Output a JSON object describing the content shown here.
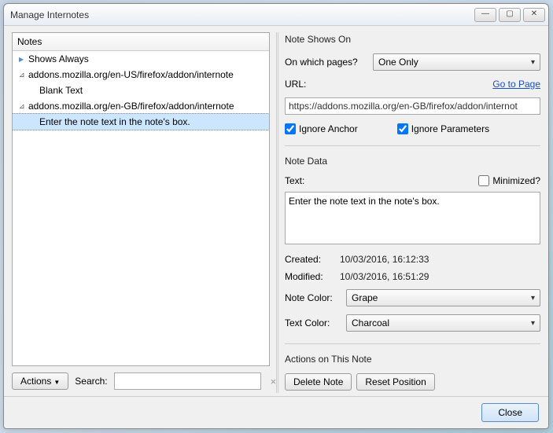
{
  "title": "Manage Internotes",
  "left": {
    "header": "Notes",
    "rows": [
      {
        "level": 1,
        "label": "Shows Always",
        "icon": "right"
      },
      {
        "level": 1,
        "label": "addons.mozilla.org/en-US/firefox/addon/internote",
        "icon": "down"
      },
      {
        "level": 2,
        "label": "Blank Text"
      },
      {
        "level": 1,
        "label": "addons.mozilla.org/en-GB/firefox/addon/internote",
        "icon": "down"
      },
      {
        "level": 2,
        "label": "Enter the note text in the note's box.",
        "selected": true
      }
    ],
    "actions_label": "Actions",
    "search_label": "Search:"
  },
  "right": {
    "group_shows": "Note Shows On",
    "pages_label": "On which pages?",
    "pages_value": "One Only",
    "url_label": "URL:",
    "go_to_page": "Go to Page",
    "url_value": "https://addons.mozilla.org/en-GB/firefox/addon/internot",
    "ignore_anchor": "Ignore Anchor",
    "ignore_params": "Ignore Parameters",
    "group_data": "Note Data",
    "text_label": "Text:",
    "minimized_label": "Minimized?",
    "text_value": "Enter the note text in the note's box.",
    "created_label": "Created:",
    "created_value": "10/03/2016, 16:12:33",
    "modified_label": "Modified:",
    "modified_value": "10/03/2016, 16:51:29",
    "note_color_label": "Note Color:",
    "note_color_value": "Grape",
    "text_color_label": "Text Color:",
    "text_color_value": "Charcoal",
    "group_actions": "Actions on This Note",
    "delete_label": "Delete Note",
    "reset_label": "Reset Position"
  },
  "close_label": "Close"
}
